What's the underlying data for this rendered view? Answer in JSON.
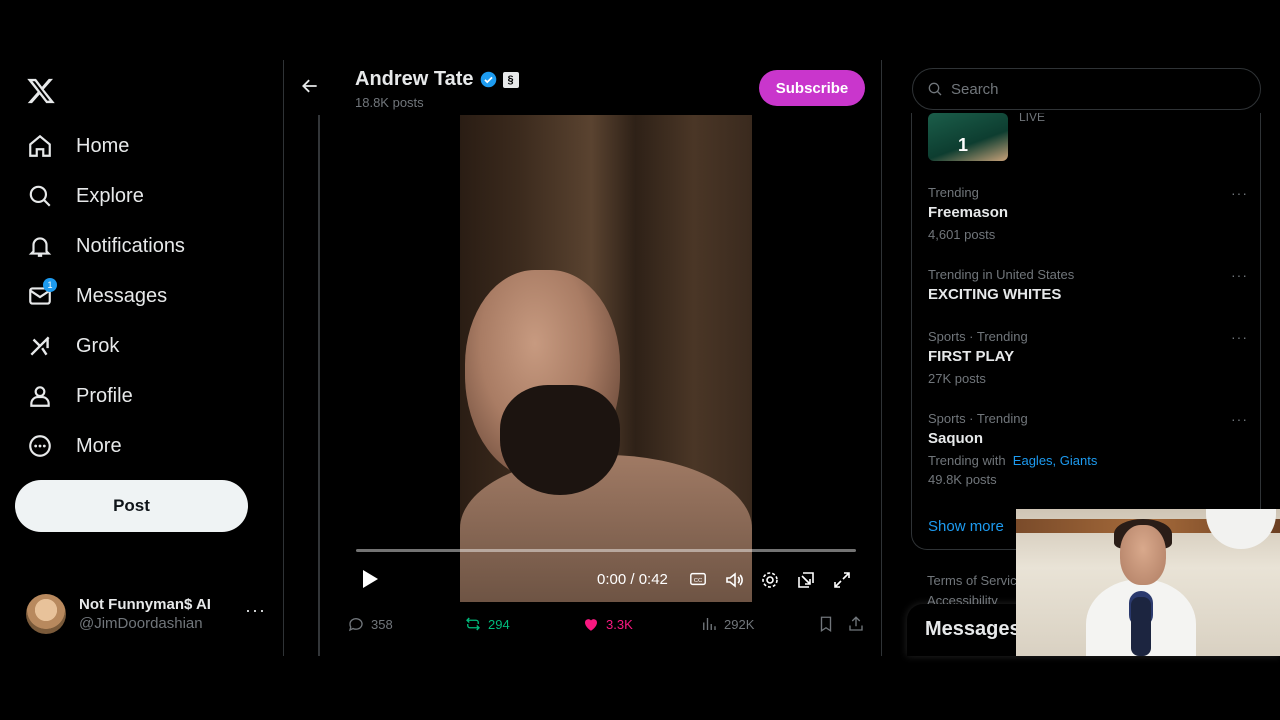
{
  "nav": {
    "items": [
      {
        "label": "Home",
        "icon": "home-icon"
      },
      {
        "label": "Explore",
        "icon": "search-icon"
      },
      {
        "label": "Notifications",
        "icon": "bell-icon"
      },
      {
        "label": "Messages",
        "icon": "mail-icon",
        "badge": "1"
      },
      {
        "label": "Grok",
        "icon": "grok-icon"
      },
      {
        "label": "Profile",
        "icon": "person-icon"
      },
      {
        "label": "More",
        "icon": "more-circle-icon"
      }
    ],
    "post_label": "Post"
  },
  "account": {
    "name": "Not Funnyman$ AI",
    "handle": "@JimDoordashian"
  },
  "header": {
    "name": "Andrew Tate",
    "posts": "18.8K posts",
    "subscribe_label": "Subscribe",
    "affiliate_glyph": "§"
  },
  "video": {
    "time": "0:00 / 0:42",
    "progress": 0.0
  },
  "actions": {
    "replies": "358",
    "reposts": "294",
    "likes": "3.3K",
    "views": "292K"
  },
  "search": {
    "placeholder": "Search"
  },
  "trends": {
    "live_label": "LIVE",
    "live_jersey": "1",
    "items": [
      {
        "meta": "Trending",
        "title": "Freemason",
        "count": "4,601 posts"
      },
      {
        "meta": "Trending in United States",
        "title": "EXCITING WHITES",
        "count": ""
      },
      {
        "meta": "Sports · Trending",
        "title": "FIRST PLAY",
        "count": "27K posts"
      },
      {
        "meta": "Sports · Trending",
        "title": "Saquon",
        "with_label": "Trending with",
        "with_links": "Eagles, Giants",
        "count": "49.8K posts"
      }
    ],
    "show_more": "Show more"
  },
  "footer": {
    "line1": "Terms of Servic",
    "line2": "Accessibility"
  },
  "messages_drawer": "Messages",
  "colors": {
    "accent": "#1d9bf0",
    "subscribe": "#c936cc",
    "like": "#f91880",
    "repost": "#00ba7c"
  }
}
